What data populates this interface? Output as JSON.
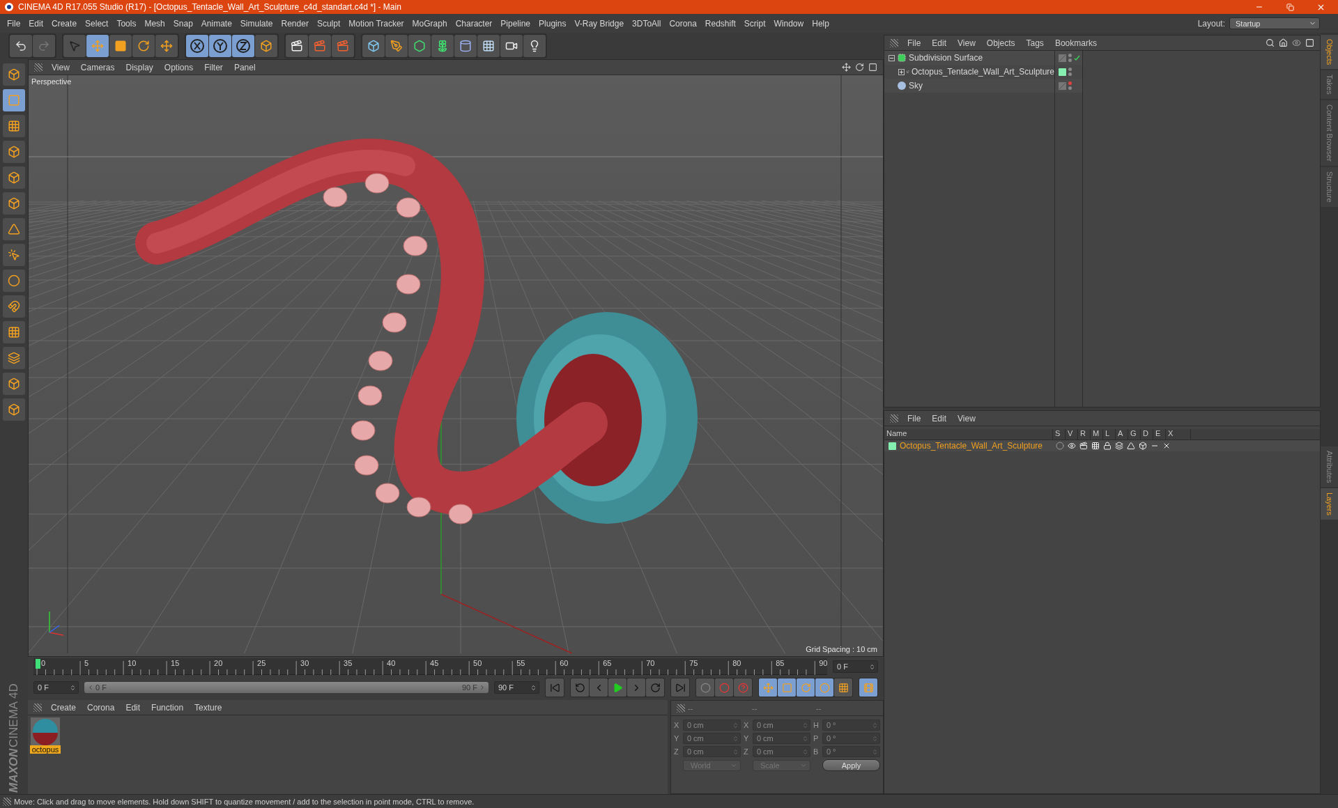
{
  "window": {
    "title": "CINEMA 4D R17.055 Studio (R17) - [Octopus_Tentacle_Wall_Art_Sculpture_c4d_standart.c4d *] - Main"
  },
  "menu": [
    "File",
    "Edit",
    "Create",
    "Select",
    "Tools",
    "Mesh",
    "Snap",
    "Animate",
    "Simulate",
    "Render",
    "Sculpt",
    "Motion Tracker",
    "MoGraph",
    "Character",
    "Pipeline",
    "Plugins",
    "V-Ray Bridge",
    "3DToAll",
    "Corona",
    "Redshift",
    "Script",
    "Window",
    "Help"
  ],
  "layout": {
    "label": "Layout:",
    "value": "Startup"
  },
  "toolbar": [
    {
      "selected": false
    },
    {
      "selected": false
    },
    {
      "selected": false
    },
    {
      "selected": true
    },
    {
      "selected": false
    },
    {
      "selected": false
    },
    {
      "selected": false
    },
    {
      "selected": true
    },
    {
      "selected": true
    },
    {
      "selected": true
    },
    {
      "selected": false
    },
    {
      "selected": false
    },
    {
      "selected": false
    },
    {
      "selected": false
    },
    {
      "selected": false
    },
    {
      "selected": false
    },
    {
      "selected": false
    },
    {
      "selected": false
    },
    {
      "selected": false
    },
    {
      "selected": false
    },
    {
      "selected": false
    },
    {
      "selected": false
    }
  ],
  "left_tools": [
    {
      "selected": false
    },
    {
      "selected": true
    },
    {
      "selected": false
    },
    {
      "selected": false
    },
    {
      "selected": false
    },
    {
      "selected": false
    },
    {
      "selected": false
    },
    {
      "selected": false
    },
    {
      "selected": false
    },
    {
      "selected": false
    },
    {
      "selected": false
    },
    {
      "selected": false
    },
    {
      "selected": false
    },
    {
      "selected": false
    }
  ],
  "viewport": {
    "menus": [
      "View",
      "Cameras",
      "Display",
      "Options",
      "Filter",
      "Panel"
    ],
    "camera": "Perspective",
    "grid_spacing": "Grid Spacing : 10 cm"
  },
  "timeline": {
    "ticks": [
      "0",
      "5",
      "10",
      "15",
      "20",
      "25",
      "30",
      "35",
      "40",
      "45",
      "50",
      "55",
      "60",
      "65",
      "70",
      "75",
      "80",
      "85",
      "90"
    ],
    "level": 0,
    "frame": "0 F",
    "start": "0 F",
    "range_start": "0 F",
    "range_end": "90 F",
    "range_slider": {
      "level": 1
    },
    "end": "90 F"
  },
  "key_modes": [
    {
      "selected": true
    },
    {
      "selected": true
    },
    {
      "selected": true
    },
    {
      "selected": true
    },
    {
      "selected": false
    },
    {
      "selected": true
    }
  ],
  "materials": {
    "menus": [
      "Create",
      "Corona",
      "Edit",
      "Function",
      "Texture"
    ],
    "items": [
      {
        "name": "octopus",
        "selected": true
      }
    ]
  },
  "coordinates": {
    "headers": [
      "--",
      "--",
      "--"
    ],
    "disabled": true,
    "rows": [
      {
        "cells": [
          {
            "axis": "X",
            "value": "0 cm"
          },
          {
            "axis": "X",
            "value": "0 cm"
          },
          {
            "axis": "H",
            "value": "0 °"
          }
        ]
      },
      {
        "cells": [
          {
            "axis": "Y",
            "value": "0 cm"
          },
          {
            "axis": "Y",
            "value": "0 cm"
          },
          {
            "axis": "P",
            "value": "0 °"
          }
        ]
      },
      {
        "cells": [
          {
            "axis": "Z",
            "value": "0 cm"
          },
          {
            "axis": "Z",
            "value": "0 cm"
          },
          {
            "axis": "B",
            "value": "0 °"
          }
        ]
      }
    ],
    "dropdowns": [
      "World",
      "Scale"
    ],
    "apply": "Apply"
  },
  "objects": {
    "menus": [
      "File",
      "Edit",
      "View",
      "Objects",
      "Tags",
      "Bookmarks"
    ],
    "items": [
      {
        "name": "Subdivision Surface",
        "kind": "generator",
        "expanded": true,
        "check": true,
        "editor_off": false,
        "children": [
          {
            "name": "Octopus_Tentacle_Wall_Art_Sculpture",
            "kind": "polygon",
            "expanded": false,
            "check": false,
            "editor_off": false,
            "color": "#86f0b0"
          }
        ]
      },
      {
        "name": "Sky",
        "kind": "sky",
        "check": false,
        "editor_off": true
      }
    ]
  },
  "layers": {
    "menus": [
      "File",
      "Edit",
      "View"
    ],
    "columns": [
      "Name",
      "S",
      "V",
      "R",
      "M",
      "L",
      "A",
      "G",
      "D",
      "E",
      "X"
    ],
    "rows": [
      {
        "name": "Octopus_Tentacle_Wall_Art_Sculpture",
        "color": "#86f0b0"
      }
    ]
  },
  "side_tabs_top": [
    {
      "label": "Objects",
      "selected": true
    },
    {
      "label": "Takes",
      "selected": false
    },
    {
      "label": "Content Browser",
      "selected": false
    },
    {
      "label": "Structure",
      "selected": false
    }
  ],
  "side_tabs_bottom": [
    {
      "label": "Attributes",
      "selected": false
    },
    {
      "label": "Layers",
      "selected": true
    }
  ],
  "logo": {
    "brand": "MAXON",
    "product": "CINEMA 4D"
  },
  "status": "Move: Click and drag to move elements. Hold down SHIFT to quantize movement / add to the selection in point mode, CTRL to remove."
}
